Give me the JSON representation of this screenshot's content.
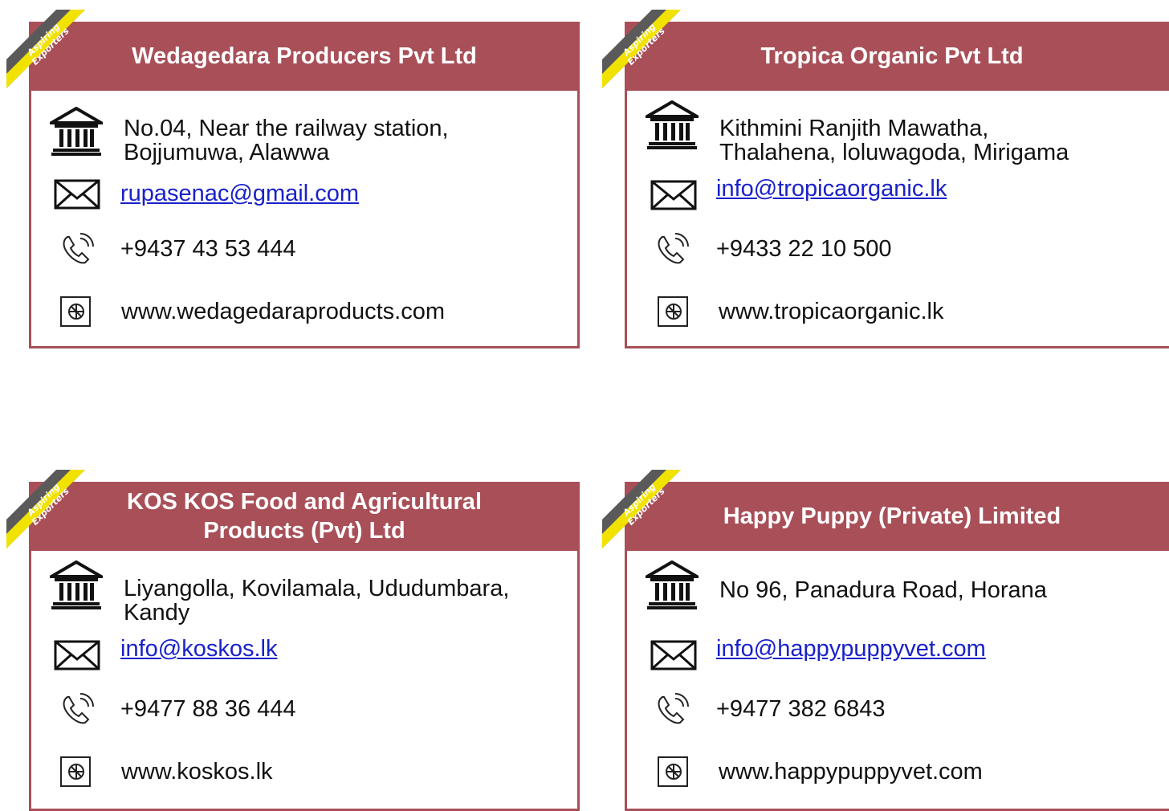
{
  "badge": {
    "line1": "Aspiring",
    "line2": "Exporters"
  },
  "colors": {
    "header": "#a84f58",
    "link": "#1a21c9",
    "badge_yellow": "#f2e200",
    "badge_gray": "#5a5a5a"
  },
  "icons": {
    "address": "bank-building-icon",
    "email": "envelope-icon",
    "phone": "phone-icon",
    "web": "globe-web-icon"
  },
  "cards": [
    {
      "name": "Wedagedara Producers Pvt Ltd",
      "address_line1": "No.04, Near the railway station,",
      "address_line2": "Bojjumuwa, Alawwa",
      "email": "rupasenac@gmail.com",
      "phone": "+9437 43 53 444",
      "website": "www.wedagedaraproducts.com"
    },
    {
      "name": "Tropica Organic Pvt Ltd",
      "address_line1": "Kithmini Ranjith Mawatha,",
      "address_line2": "Thalahena, loluwagoda, Mirigama",
      "email": "info@tropicaorganic.lk",
      "phone": "+9433 22 10 500",
      "website": "www.tropicaorganic.lk"
    },
    {
      "name_line1": "KOS KOS Food and Agricultural",
      "name_line2": "Products (Pvt) Ltd",
      "address_line1": "Liyangolla, Kovilamala, Ududumbara,",
      "address_line2": "Kandy",
      "email": "info@koskos.lk",
      "phone": "+9477 88 36 444",
      "website": "www.koskos.lk"
    },
    {
      "name": "Happy Puppy (Private) Limited",
      "address_line1": "No 96, Panadura Road, Horana",
      "email": "info@happypuppyvet.com",
      "phone": "+9477 382 6843",
      "website": "www.happypuppyvet.com"
    }
  ]
}
